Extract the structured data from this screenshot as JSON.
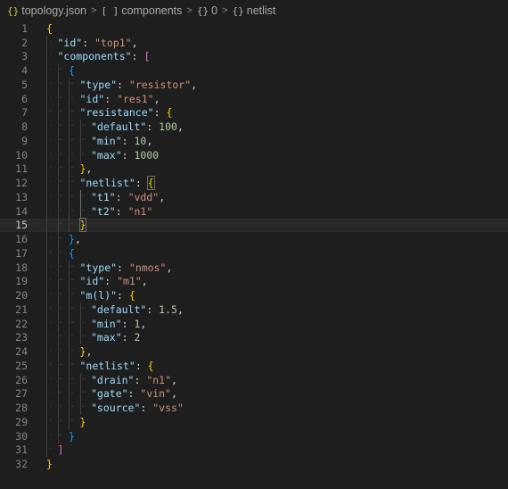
{
  "breadcrumb": {
    "file_label": "topology.json",
    "components_label": "components",
    "index_label": "0",
    "netlist_label": "netlist",
    "file_icon": "{}",
    "array_icon": "[ ]",
    "object_icon": "{}",
    "separator": ">"
  },
  "editor": {
    "current_line": 15,
    "lines": [
      {
        "n": "1",
        "indent": 0,
        "tokens": [
          {
            "t": "{",
            "c": "b1"
          }
        ]
      },
      {
        "n": "2",
        "indent": 1,
        "tokens": [
          {
            "t": "\"id\"",
            "c": "k"
          },
          {
            "t": ": ",
            "c": "p"
          },
          {
            "t": "\"top1\"",
            "c": "s"
          },
          {
            "t": ",",
            "c": "p"
          }
        ]
      },
      {
        "n": "3",
        "indent": 1,
        "tokens": [
          {
            "t": "\"components\"",
            "c": "k"
          },
          {
            "t": ": ",
            "c": "p"
          },
          {
            "t": "[",
            "c": "b2"
          }
        ]
      },
      {
        "n": "4",
        "indent": 2,
        "tokens": [
          {
            "t": "{",
            "c": "b3"
          }
        ]
      },
      {
        "n": "5",
        "indent": 3,
        "tokens": [
          {
            "t": "\"type\"",
            "c": "k"
          },
          {
            "t": ": ",
            "c": "p"
          },
          {
            "t": "\"resistor\"",
            "c": "s"
          },
          {
            "t": ",",
            "c": "p"
          }
        ]
      },
      {
        "n": "6",
        "indent": 3,
        "tokens": [
          {
            "t": "\"id\"",
            "c": "k"
          },
          {
            "t": ": ",
            "c": "p"
          },
          {
            "t": "\"res1\"",
            "c": "s"
          },
          {
            "t": ",",
            "c": "p"
          }
        ]
      },
      {
        "n": "7",
        "indent": 3,
        "tokens": [
          {
            "t": "\"resistance\"",
            "c": "k"
          },
          {
            "t": ": ",
            "c": "p"
          },
          {
            "t": "{",
            "c": "b1"
          }
        ]
      },
      {
        "n": "8",
        "indent": 4,
        "tokens": [
          {
            "t": "\"default\"",
            "c": "k"
          },
          {
            "t": ": ",
            "c": "p"
          },
          {
            "t": "100",
            "c": "n"
          },
          {
            "t": ",",
            "c": "p"
          }
        ]
      },
      {
        "n": "9",
        "indent": 4,
        "tokens": [
          {
            "t": "\"min\"",
            "c": "k"
          },
          {
            "t": ": ",
            "c": "p"
          },
          {
            "t": "10",
            "c": "n"
          },
          {
            "t": ",",
            "c": "p"
          }
        ]
      },
      {
        "n": "10",
        "indent": 4,
        "tokens": [
          {
            "t": "\"max\"",
            "c": "k"
          },
          {
            "t": ": ",
            "c": "p"
          },
          {
            "t": "1000",
            "c": "n"
          }
        ]
      },
      {
        "n": "11",
        "indent": 3,
        "tokens": [
          {
            "t": "}",
            "c": "b1"
          },
          {
            "t": ",",
            "c": "p"
          }
        ]
      },
      {
        "n": "12",
        "indent": 3,
        "tokens": [
          {
            "t": "\"netlist\"",
            "c": "k"
          },
          {
            "t": ": ",
            "c": "p"
          },
          {
            "t": "{",
            "c": "b1",
            "match": true
          }
        ]
      },
      {
        "n": "13",
        "indent": 4,
        "tokens": [
          {
            "t": "\"t1\"",
            "c": "k"
          },
          {
            "t": ": ",
            "c": "p"
          },
          {
            "t": "\"vdd\"",
            "c": "s"
          },
          {
            "t": ",",
            "c": "p"
          }
        ]
      },
      {
        "n": "14",
        "indent": 4,
        "tokens": [
          {
            "t": "\"t2\"",
            "c": "k"
          },
          {
            "t": ": ",
            "c": "p"
          },
          {
            "t": "\"n1\"",
            "c": "s"
          }
        ]
      },
      {
        "n": "15",
        "indent": 3,
        "tokens": [
          {
            "t": "}",
            "c": "b1",
            "match": true
          }
        ]
      },
      {
        "n": "16",
        "indent": 2,
        "tokens": [
          {
            "t": "}",
            "c": "b3"
          },
          {
            "t": ",",
            "c": "p"
          }
        ]
      },
      {
        "n": "17",
        "indent": 2,
        "tokens": [
          {
            "t": "{",
            "c": "b3"
          }
        ]
      },
      {
        "n": "18",
        "indent": 3,
        "tokens": [
          {
            "t": "\"type\"",
            "c": "k"
          },
          {
            "t": ": ",
            "c": "p"
          },
          {
            "t": "\"nmos\"",
            "c": "s"
          },
          {
            "t": ",",
            "c": "p"
          }
        ]
      },
      {
        "n": "19",
        "indent": 3,
        "tokens": [
          {
            "t": "\"id\"",
            "c": "k"
          },
          {
            "t": ": ",
            "c": "p"
          },
          {
            "t": "\"m1\"",
            "c": "s"
          },
          {
            "t": ",",
            "c": "p"
          }
        ]
      },
      {
        "n": "20",
        "indent": 3,
        "tokens": [
          {
            "t": "\"m(l)\"",
            "c": "k"
          },
          {
            "t": ": ",
            "c": "p"
          },
          {
            "t": "{",
            "c": "b1"
          }
        ]
      },
      {
        "n": "21",
        "indent": 4,
        "tokens": [
          {
            "t": "\"default\"",
            "c": "k"
          },
          {
            "t": ": ",
            "c": "p"
          },
          {
            "t": "1.5",
            "c": "n"
          },
          {
            "t": ",",
            "c": "p"
          }
        ]
      },
      {
        "n": "22",
        "indent": 4,
        "tokens": [
          {
            "t": "\"min\"",
            "c": "k"
          },
          {
            "t": ": ",
            "c": "p"
          },
          {
            "t": "1",
            "c": "n"
          },
          {
            "t": ",",
            "c": "p"
          }
        ]
      },
      {
        "n": "23",
        "indent": 4,
        "tokens": [
          {
            "t": "\"max\"",
            "c": "k"
          },
          {
            "t": ": ",
            "c": "p"
          },
          {
            "t": "2",
            "c": "n"
          }
        ]
      },
      {
        "n": "24",
        "indent": 3,
        "tokens": [
          {
            "t": "}",
            "c": "b1"
          },
          {
            "t": ",",
            "c": "p"
          }
        ]
      },
      {
        "n": "25",
        "indent": 3,
        "tokens": [
          {
            "t": "\"netlist\"",
            "c": "k"
          },
          {
            "t": ": ",
            "c": "p"
          },
          {
            "t": "{",
            "c": "b1"
          }
        ]
      },
      {
        "n": "26",
        "indent": 4,
        "tokens": [
          {
            "t": "\"drain\"",
            "c": "k"
          },
          {
            "t": ": ",
            "c": "p"
          },
          {
            "t": "\"n1\"",
            "c": "s"
          },
          {
            "t": ",",
            "c": "p"
          }
        ]
      },
      {
        "n": "27",
        "indent": 4,
        "tokens": [
          {
            "t": "\"gate\"",
            "c": "k"
          },
          {
            "t": ": ",
            "c": "p"
          },
          {
            "t": "\"vin\"",
            "c": "s"
          },
          {
            "t": ",",
            "c": "p"
          }
        ]
      },
      {
        "n": "28",
        "indent": 4,
        "tokens": [
          {
            "t": "\"source\"",
            "c": "k"
          },
          {
            "t": ": ",
            "c": "p"
          },
          {
            "t": "\"vss\"",
            "c": "s"
          }
        ]
      },
      {
        "n": "29",
        "indent": 3,
        "tokens": [
          {
            "t": "}",
            "c": "b1"
          }
        ]
      },
      {
        "n": "30",
        "indent": 2,
        "tokens": [
          {
            "t": "}",
            "c": "b3"
          }
        ]
      },
      {
        "n": "31",
        "indent": 1,
        "tokens": [
          {
            "t": "]",
            "c": "b2"
          }
        ]
      },
      {
        "n": "32",
        "indent": 0,
        "tokens": [
          {
            "t": "}",
            "c": "b1"
          }
        ]
      }
    ]
  },
  "colors": {
    "background": "#1e1e1e",
    "key": "#9cdcfe",
    "string": "#ce9178",
    "number": "#b5cea8",
    "bracket_level1": "#ffd700",
    "bracket_level2": "#da70d6",
    "bracket_level3": "#179fff"
  }
}
